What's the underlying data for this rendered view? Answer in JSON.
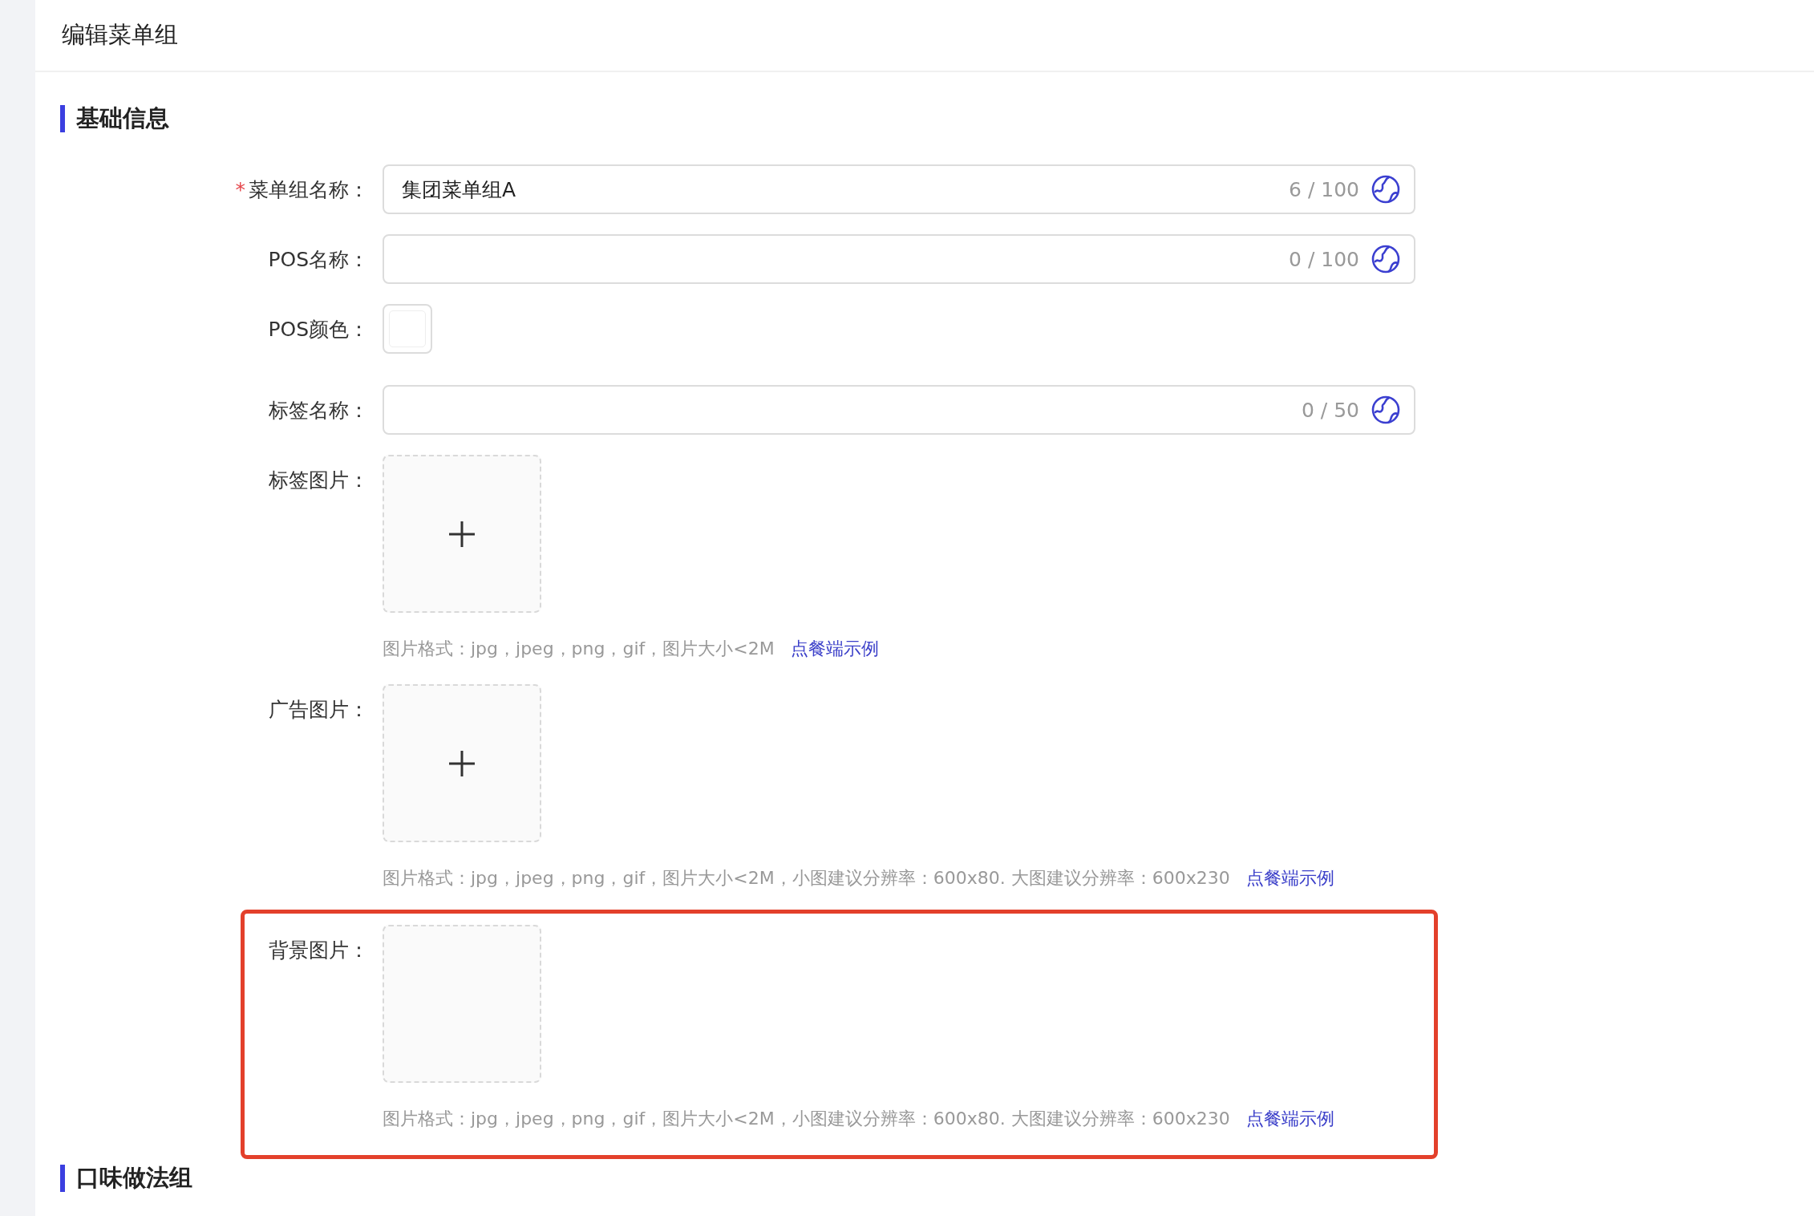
{
  "page_title": "编辑菜单组",
  "sections": [
    {
      "title": "基础信息",
      "fields": [
        {
          "kind": "text",
          "label": "菜单组名称：",
          "mark": "*",
          "value": "集团菜单组A",
          "counter": "6 / 100",
          "highlighted": false
        },
        {
          "kind": "text",
          "label": "POS名称：",
          "counter": "0 / 100",
          "highlighted": false
        },
        {
          "kind": "color",
          "label": "POS颜色：",
          "highlighted": false
        },
        {
          "kind": "text",
          "label": "标签名称：",
          "counter": "0 / 50",
          "highlighted": false
        },
        {
          "kind": "upload",
          "label": "标签图片：",
          "plus": true,
          "hint": "图片格式：jpg，jpeg，png，gif，图片大小<2M",
          "link": "点餐端示例",
          "highlighted": false
        },
        {
          "kind": "upload",
          "label": "广告图片：",
          "plus": true,
          "hint": "图片格式：jpg，jpeg，png，gif，图片大小<2M，小图建议分辨率：600x80. 大图建议分辨率：600x230",
          "link": "点餐端示例",
          "highlighted": false
        },
        {
          "kind": "upload",
          "label": "背景图片：",
          "plus": false,
          "hint": "图片格式：jpg，jpeg，png，gif，图片大小<2M，小图建议分辨率：600x80. 大图建议分辨率：600x230",
          "link": "点餐端示例",
          "highlighted": true
        }
      ]
    },
    {
      "title": "口味做法组"
    }
  ]
}
